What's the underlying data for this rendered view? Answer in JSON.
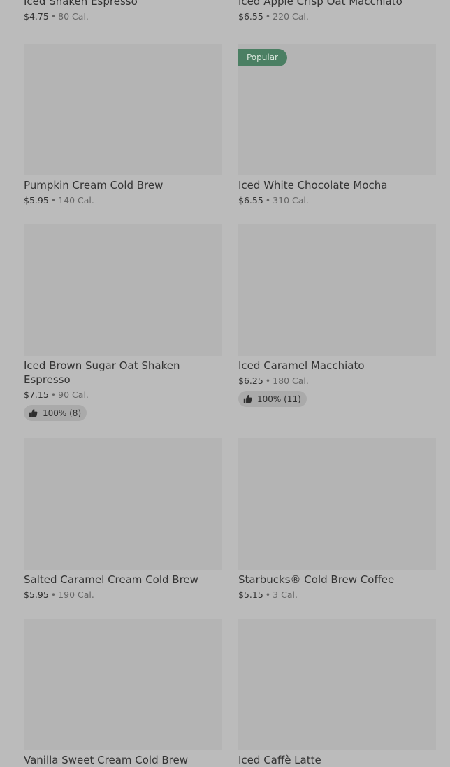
{
  "products": [
    {
      "name": "Iced Shaken Espresso",
      "price": "$4.75",
      "sep": "•",
      "calories": "80 Cal."
    },
    {
      "name": "Iced Apple Crisp Oat Macchiato",
      "price": "$6.55",
      "sep": "•",
      "calories": "220 Cal."
    },
    {
      "name": "Pumpkin Cream Cold Brew",
      "price": "$5.95",
      "sep": "•",
      "calories": "140 Cal."
    },
    {
      "name": "Iced White Chocolate Mocha",
      "price": "$6.55",
      "sep": "•",
      "calories": "310 Cal.",
      "badge": "Popular"
    },
    {
      "name": "Iced Brown Sugar Oat Shaken Espresso",
      "price": "$7.15",
      "sep": "•",
      "calories": "90 Cal.",
      "rating": "100% (8)"
    },
    {
      "name": "Iced Caramel Macchiato",
      "price": "$6.25",
      "sep": "•",
      "calories": "180 Cal.",
      "rating": "100% (11)"
    },
    {
      "name": "Salted Caramel Cream Cold Brew",
      "price": "$5.95",
      "sep": "•",
      "calories": "190 Cal."
    },
    {
      "name": "Starbucks® Cold Brew Coffee",
      "price": "$5.15",
      "sep": "•",
      "calories": "3 Cal."
    },
    {
      "name": "Vanilla Sweet Cream Cold Brew"
    },
    {
      "name": "Iced Caffè Latte"
    }
  ],
  "colors": {
    "page_background": "#bbbbbb",
    "image_placeholder": "#b4b4b4",
    "badge_background": "#4b7f63",
    "rating_background": "#aaaaaa"
  },
  "icons": {
    "rating": "thumbs-up-icon"
  }
}
